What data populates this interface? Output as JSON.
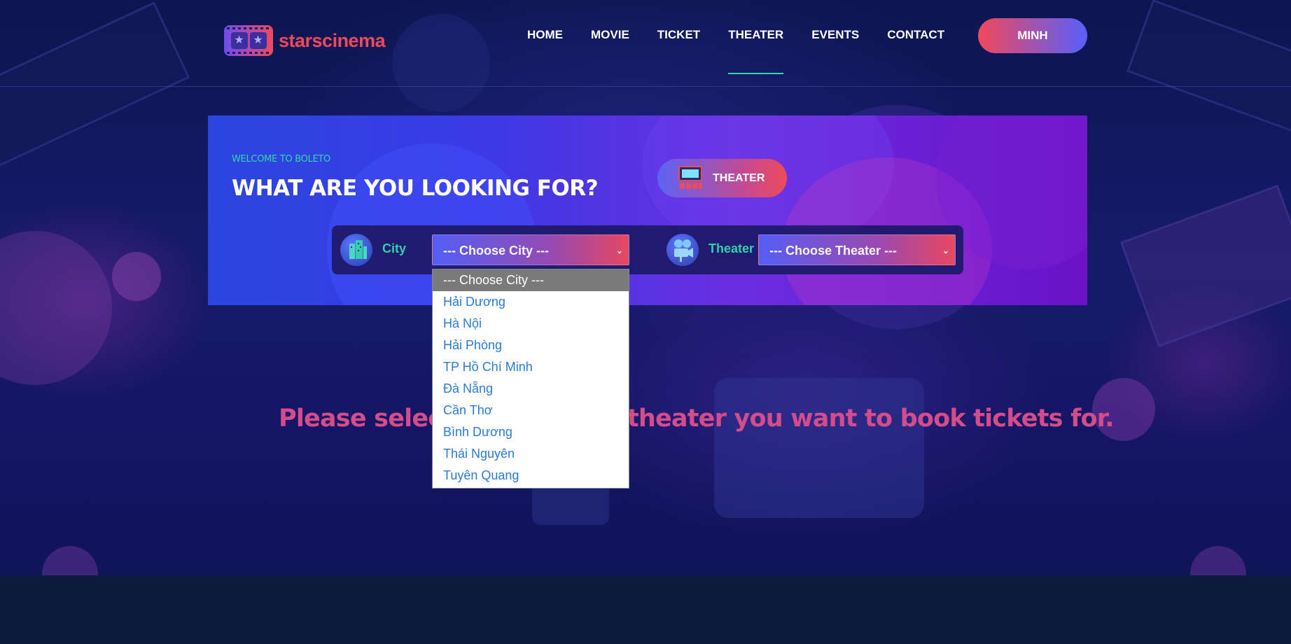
{
  "brand": {
    "name": "starscinema"
  },
  "nav": {
    "items": [
      {
        "label": "HOME"
      },
      {
        "label": "MOVIE"
      },
      {
        "label": "TICKET"
      },
      {
        "label": "THEATER"
      },
      {
        "label": "EVENTS"
      },
      {
        "label": "CONTACT"
      }
    ],
    "active": "THEATER",
    "user_label": "MINH"
  },
  "banner": {
    "welcome": "WELCOME TO BOLETO",
    "question": "WHAT ARE YOU LOOKING FOR?",
    "category_label": "THEATER",
    "city_label": "City",
    "city_value": "--- Choose City ---",
    "theater_label": "Theater",
    "theater_value": "--- Choose Theater ---"
  },
  "city_dropdown": {
    "options": [
      "--- Choose City ---",
      "Hải Dương",
      "Hà Nội",
      "Hải Phòng",
      "TP Hồ Chí Minh",
      "Đà Nẵng",
      "Cần Thơ",
      "Bình Dương",
      "Thái Nguyên",
      "Tuyên Quang"
    ],
    "selected": "--- Choose City ---"
  },
  "message": "Please select the city and theater you want to book tickets for.",
  "colors": {
    "accent_green": "#31d7a9",
    "accent_red": "#ee4a5a",
    "accent_blue": "#5560f5",
    "message_pink": "#d44c8a"
  }
}
